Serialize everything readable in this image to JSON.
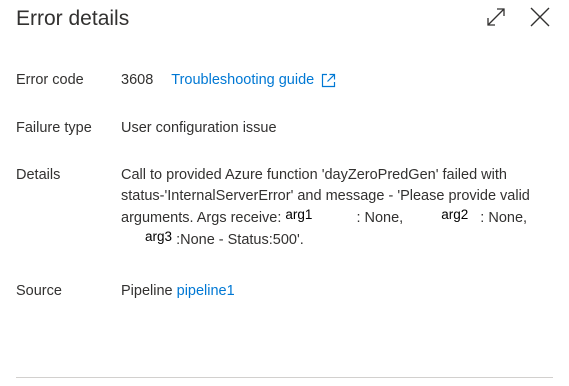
{
  "panel": {
    "title": "Error details"
  },
  "header_icons": {
    "maximize": "maximize-icon",
    "close": "close-icon"
  },
  "fields": {
    "error_code": {
      "label": "Error code",
      "value": "3608",
      "link_text": "Troubleshooting guide"
    },
    "failure_type": {
      "label": "Failure type",
      "value": "User configuration issue"
    },
    "details": {
      "label": "Details",
      "text_part1": "Call to provided Azure function 'dayZeroPredGen' failed with status-'InternalServerError' and message - 'Please provide valid arguments. Args receive:",
      "arg1": "arg1",
      "text_part2": ": None,",
      "arg2": "arg2",
      "text_part3": ": None,",
      "arg3": "arg3",
      "text_part4": ":None - Status:500'."
    },
    "source": {
      "label": "Source",
      "prefix": "Pipeline",
      "link_text": "pipeline1"
    }
  },
  "colors": {
    "link": "#0078d4",
    "text": "#323130",
    "divider": "#d2d0ce"
  }
}
